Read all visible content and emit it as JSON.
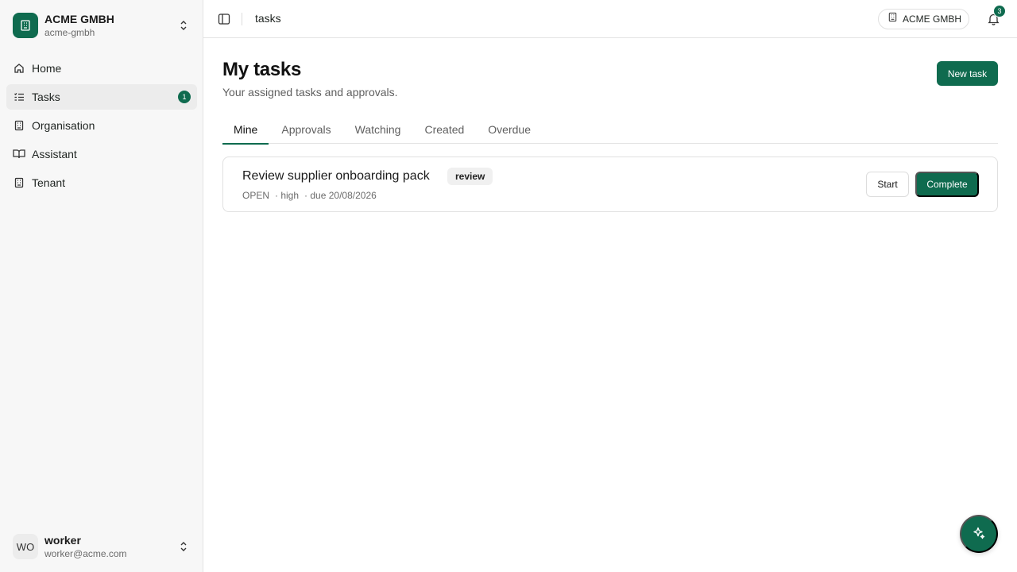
{
  "colors": {
    "accent": "#0f6b4f",
    "sidebar_bg": "#f7f7f7",
    "border": "#e4e4e4"
  },
  "org": {
    "name": "ACME GMBH",
    "slug": "acme-gmbh",
    "logo_icon": "building-icon",
    "switch_icon": "chevrons-up-down-icon"
  },
  "sidebar": {
    "items": [
      {
        "label": "Home",
        "icon": "home-icon"
      },
      {
        "label": "Tasks",
        "icon": "list-checks-icon",
        "badge": "1",
        "active": true
      },
      {
        "label": "Organisation",
        "icon": "building-icon"
      },
      {
        "label": "Assistant",
        "icon": "book-open-icon"
      },
      {
        "label": "Tenant",
        "icon": "building-icon"
      }
    ]
  },
  "user": {
    "initials": "WO",
    "name": "worker",
    "email": "worker@acme.com"
  },
  "header": {
    "breadcrumb": "tasks",
    "tenant_label": "ACME GMBH",
    "notification_count": "3"
  },
  "main": {
    "title": "My tasks",
    "subtitle": "Your assigned tasks and approvals.",
    "new_task_label": "New task",
    "tabs": [
      {
        "label": "Mine",
        "active": true
      },
      {
        "label": "Approvals"
      },
      {
        "label": "Watching"
      },
      {
        "label": "Created"
      },
      {
        "label": "Overdue"
      }
    ],
    "tasks": [
      {
        "title": "Review supplier onboarding pack",
        "tag": "review",
        "status": "OPEN",
        "priority": "· high",
        "due": "· due 20/08/2026",
        "start_label": "Start",
        "complete_label": "Complete"
      }
    ]
  }
}
